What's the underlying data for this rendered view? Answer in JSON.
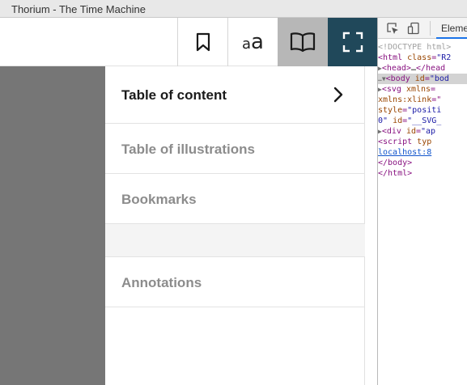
{
  "window": {
    "title": "Thorium - The Time Machine"
  },
  "toolbar": {
    "bookmark_icon": "bookmark-icon",
    "settings_icon": "text-size-icon",
    "settings_small": "a",
    "settings_big": "a",
    "toc_icon": "open-book-icon",
    "fullscreen_icon": "fullscreen-icon",
    "active_color": "#b7b7b7",
    "fullscreen_color": "#20485a"
  },
  "menu": {
    "items": [
      {
        "label": "Table of content",
        "active": true,
        "icon": "chevron-right-icon"
      },
      {
        "label": "Table of illustrations",
        "active": false
      },
      {
        "label": "Bookmarks",
        "active": false
      },
      {
        "label": "",
        "active": false
      },
      {
        "label": "Annotations",
        "active": false
      }
    ]
  },
  "devtools": {
    "inspect_icon": "inspect-element-icon",
    "device_icon": "device-toolbar-icon",
    "tab_label": "Eleme",
    "lines": [
      {
        "indent": "",
        "parts": [
          [
            "c-gray",
            "<!DOCTYPE html>"
          ]
        ]
      },
      {
        "indent": "",
        "parts": [
          [
            "c-tag",
            "<html "
          ],
          [
            "c-attr",
            "class"
          ],
          [
            "c-tag",
            "="
          ],
          [
            "c-val",
            "\"R2"
          ]
        ]
      },
      {
        "indent": " ▶",
        "parts": [
          [
            "c-tag",
            "<head>"
          ],
          [
            "c-text",
            "…"
          ],
          [
            "c-tag",
            "</head"
          ]
        ]
      },
      {
        "indent": "…▼",
        "parts": [
          [
            "c-tag",
            "<body "
          ],
          [
            "c-attr",
            "id"
          ],
          [
            "c-tag",
            "="
          ],
          [
            "c-val",
            "\"bod"
          ]
        ],
        "selected": true
      },
      {
        "indent": "  ▶",
        "parts": [
          [
            "c-tag",
            "<svg "
          ],
          [
            "c-attr",
            "xmlns"
          ],
          [
            "c-tag",
            "="
          ]
        ]
      },
      {
        "indent": "  ",
        "parts": [
          [
            "c-attr",
            "xmlns:xlink"
          ],
          [
            "c-tag",
            "=\""
          ]
        ]
      },
      {
        "indent": "  ",
        "parts": [
          [
            "c-attr",
            "style"
          ],
          [
            "c-tag",
            "="
          ],
          [
            "c-val",
            "\"positi"
          ]
        ]
      },
      {
        "indent": "  ",
        "parts": [
          [
            "c-val",
            "0\" "
          ],
          [
            "c-attr",
            "id"
          ],
          [
            "c-tag",
            "="
          ],
          [
            "c-val",
            "\"__SVG_"
          ]
        ]
      },
      {
        "indent": "  ▶",
        "parts": [
          [
            "c-tag",
            "<div "
          ],
          [
            "c-attr",
            "id"
          ],
          [
            "c-tag",
            "="
          ],
          [
            "c-val",
            "\"ap"
          ]
        ]
      },
      {
        "indent": "   ",
        "parts": [
          [
            "c-tag",
            "<script "
          ],
          [
            "c-attr",
            "typ"
          ]
        ]
      },
      {
        "indent": "   ",
        "parts": [
          [
            "c-link",
            "localhost:8"
          ]
        ]
      },
      {
        "indent": "  ",
        "parts": [
          [
            "c-tag",
            "</body>"
          ]
        ]
      },
      {
        "indent": "",
        "parts": [
          [
            "c-tag",
            "</html>"
          ]
        ]
      }
    ]
  }
}
